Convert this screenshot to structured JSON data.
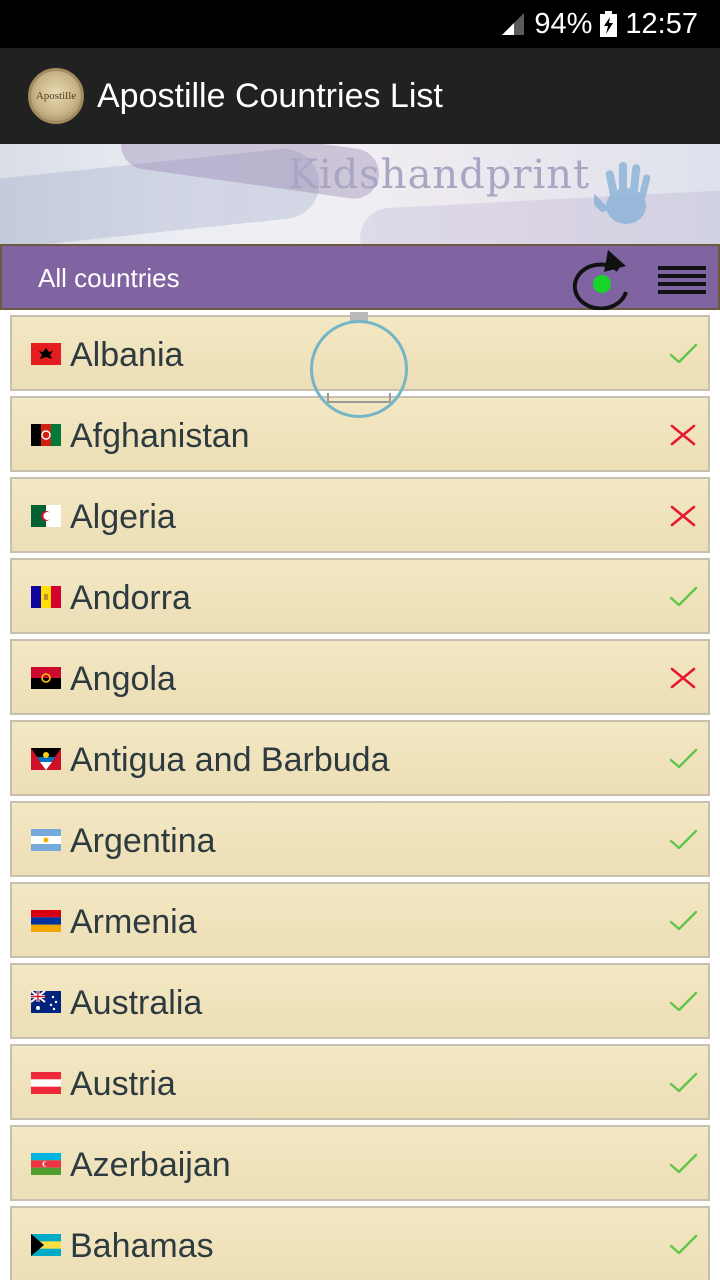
{
  "status_bar": {
    "battery": "94%",
    "time": "12:57"
  },
  "app_bar": {
    "title": "Apostille Countries List",
    "logo_text": "Apostille"
  },
  "banner": {
    "text": "Kidshandprint"
  },
  "filter": {
    "label": "All countries"
  },
  "colors": {
    "accent": "#8064a2",
    "check": "#5fc64a",
    "cross": "#e8192c"
  },
  "countries": [
    {
      "name": "Albania",
      "flag": "albania-flag",
      "status": "check"
    },
    {
      "name": "Afghanistan",
      "flag": "afghanistan-flag",
      "status": "cross"
    },
    {
      "name": "Algeria",
      "flag": "algeria-flag",
      "status": "cross"
    },
    {
      "name": "Andorra",
      "flag": "andorra-flag",
      "status": "check"
    },
    {
      "name": "Angola",
      "flag": "angola-flag",
      "status": "cross"
    },
    {
      "name": "Antigua and Barbuda",
      "flag": "antigua-flag",
      "status": "check"
    },
    {
      "name": "Argentina",
      "flag": "argentina-flag",
      "status": "check"
    },
    {
      "name": "Armenia",
      "flag": "armenia-flag",
      "status": "check"
    },
    {
      "name": "Australia",
      "flag": "australia-flag",
      "status": "check"
    },
    {
      "name": "Austria",
      "flag": "austria-flag",
      "status": "check"
    },
    {
      "name": "Azerbaijan",
      "flag": "azerbaijan-flag",
      "status": "check"
    },
    {
      "name": "Bahamas",
      "flag": "bahamas-flag",
      "status": "check"
    }
  ]
}
